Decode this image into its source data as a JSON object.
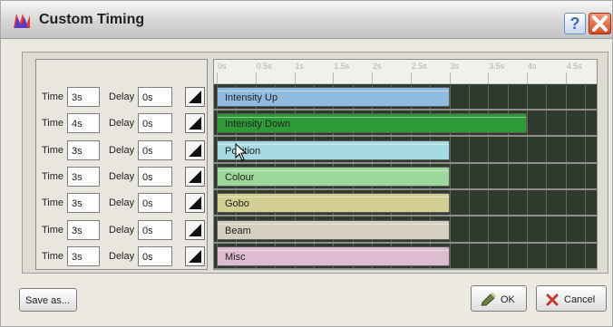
{
  "window": {
    "title": "Custom Timing"
  },
  "labels": {
    "time": "Time",
    "delay": "Delay"
  },
  "timeline": {
    "unit_ticks": [
      "0s",
      "0.5s",
      "1s",
      "1.5s",
      "2s",
      "2.5s",
      "3s",
      "3.5s",
      "4s",
      "4.5s"
    ],
    "max_seconds": 4.9
  },
  "rows": [
    {
      "name": "Intensity Up",
      "time": "3s",
      "delay": "0s",
      "duration": 3,
      "color": "#8fbbe0"
    },
    {
      "name": "Intensity Down",
      "time": "4s",
      "delay": "0s",
      "duration": 4,
      "color": "#2e9a37"
    },
    {
      "name": "Position",
      "time": "3s",
      "delay": "0s",
      "duration": 3,
      "color": "#a6dbe3"
    },
    {
      "name": "Colour",
      "time": "3s",
      "delay": "0s",
      "duration": 3,
      "color": "#9cd89a"
    },
    {
      "name": "Gobo",
      "time": "3s",
      "delay": "0s",
      "duration": 3,
      "color": "#d3cf92"
    },
    {
      "name": "Beam",
      "time": "3s",
      "delay": "0s",
      "duration": 3,
      "color": "#d4cfbf"
    },
    {
      "name": "Misc",
      "time": "3s",
      "delay": "0s",
      "duration": 3,
      "color": "#ddbcd0"
    }
  ],
  "buttons": {
    "save_as": "Save as...",
    "ok": "OK",
    "cancel": "Cancel"
  }
}
